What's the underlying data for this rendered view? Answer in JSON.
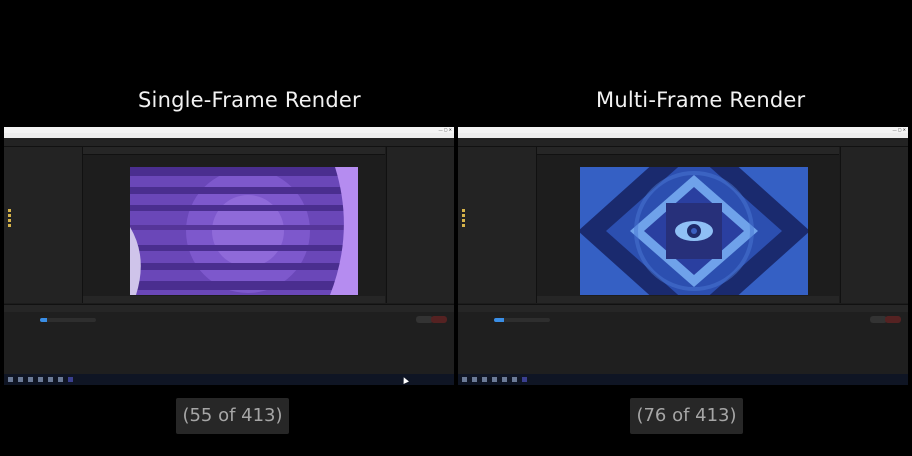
{
  "headings": {
    "left": "Single-Frame Render",
    "right": "Multi-Frame Render"
  },
  "counters": {
    "left": "(55 of 413)",
    "right": "(76 of 413)"
  },
  "panes": [
    {
      "progress": 0.13,
      "frames_label": "55 of 413",
      "canvas_theme": "purple-stripes",
      "colors": {
        "bg": "#6a47b8",
        "stripe": "#4a2e8f",
        "accent": "#b58cf0"
      }
    },
    {
      "progress": 0.18,
      "frames_label": "76 of 413",
      "canvas_theme": "blue-eye",
      "colors": {
        "bg": "#2c4fb0",
        "stripe": "#1a2a6e",
        "accent": "#6fa2ea"
      }
    }
  ],
  "icons": [
    "after-effects-window",
    "render-queue",
    "taskbar-start-icon",
    "eye-icon",
    "mouse-cursor"
  ]
}
